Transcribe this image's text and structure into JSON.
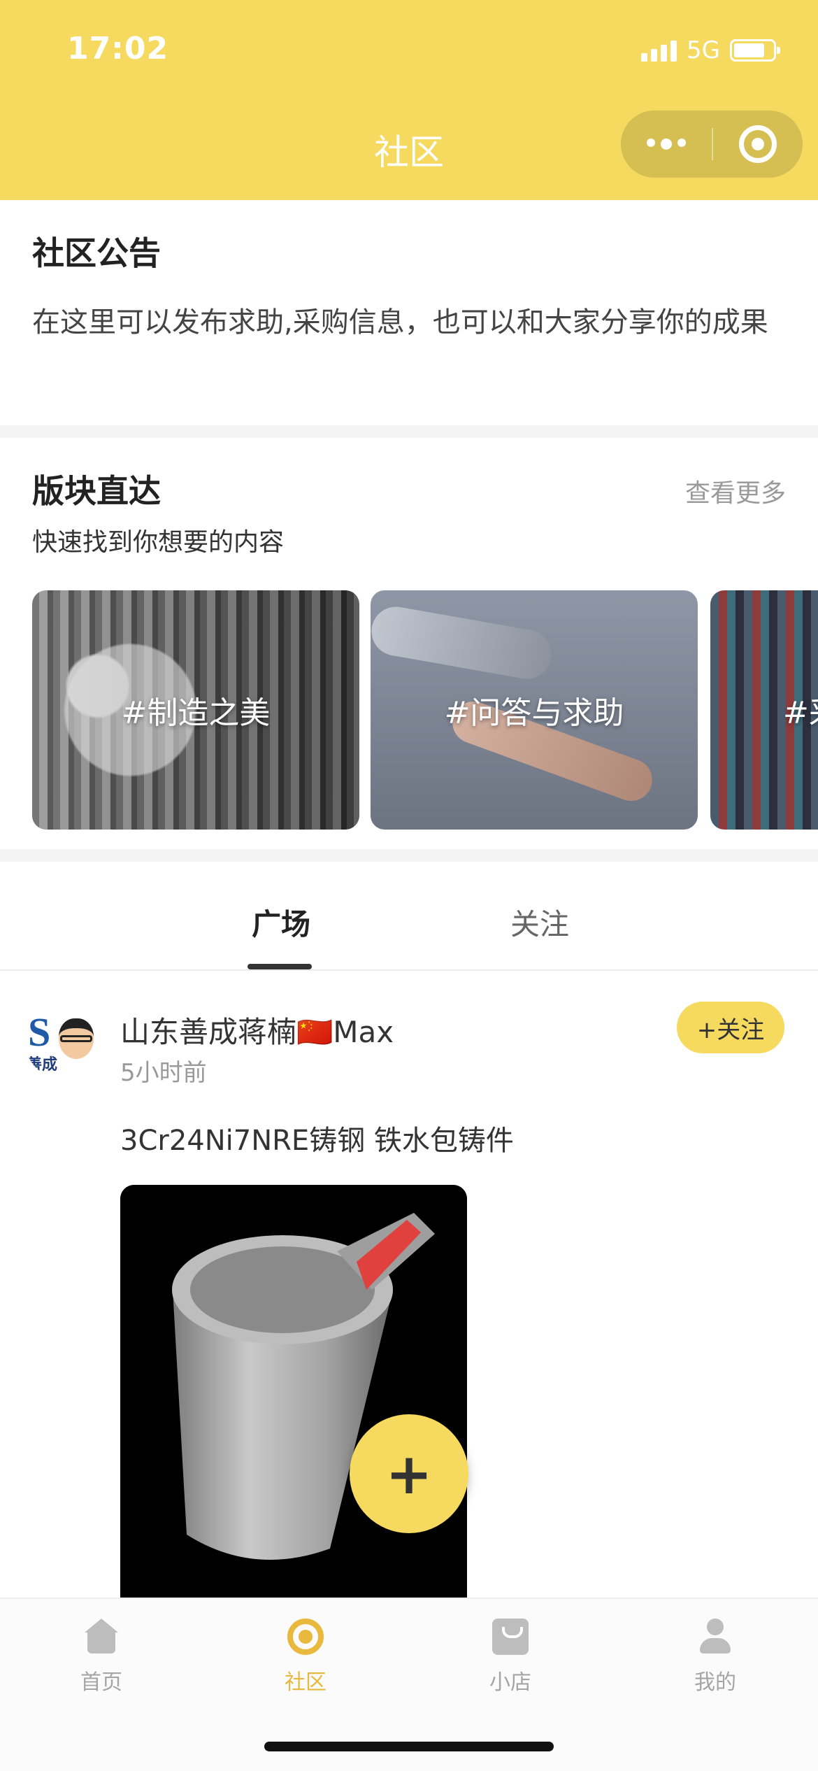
{
  "status_bar": {
    "time": "17:02",
    "network": "5G"
  },
  "nav": {
    "title": "社区"
  },
  "notice": {
    "title": "社区公告",
    "body": "在这里可以发布求助,采购信息，也可以和大家分享你的成果"
  },
  "sections": {
    "title": "版块直达",
    "more": "查看更多",
    "subtitle": "快速找到你想要的内容",
    "cards": [
      {
        "label": "#制造之美"
      },
      {
        "label": "#问答与求助"
      },
      {
        "label": "#采"
      }
    ]
  },
  "tabs": [
    {
      "label": "广场",
      "active": true
    },
    {
      "label": "关注",
      "active": false
    }
  ],
  "post": {
    "author": "山东善成蒋楠🇨🇳Max",
    "time": "5小时前",
    "follow_label": "+关注",
    "text": "3Cr24Ni7NRE铸钢 铁水包铸件",
    "avatar_text": "善成"
  },
  "fab_label": "+",
  "bottom_nav": [
    {
      "label": "首页",
      "icon": "home-icon",
      "active": false
    },
    {
      "label": "社区",
      "icon": "community-icon",
      "active": true
    },
    {
      "label": "小店",
      "icon": "shop-icon",
      "active": false
    },
    {
      "label": "我的",
      "icon": "profile-icon",
      "active": false
    }
  ],
  "colors": {
    "accent": "#f5da5f",
    "active_nav": "#e8b93c",
    "ladle_spout": "#e0413f"
  }
}
